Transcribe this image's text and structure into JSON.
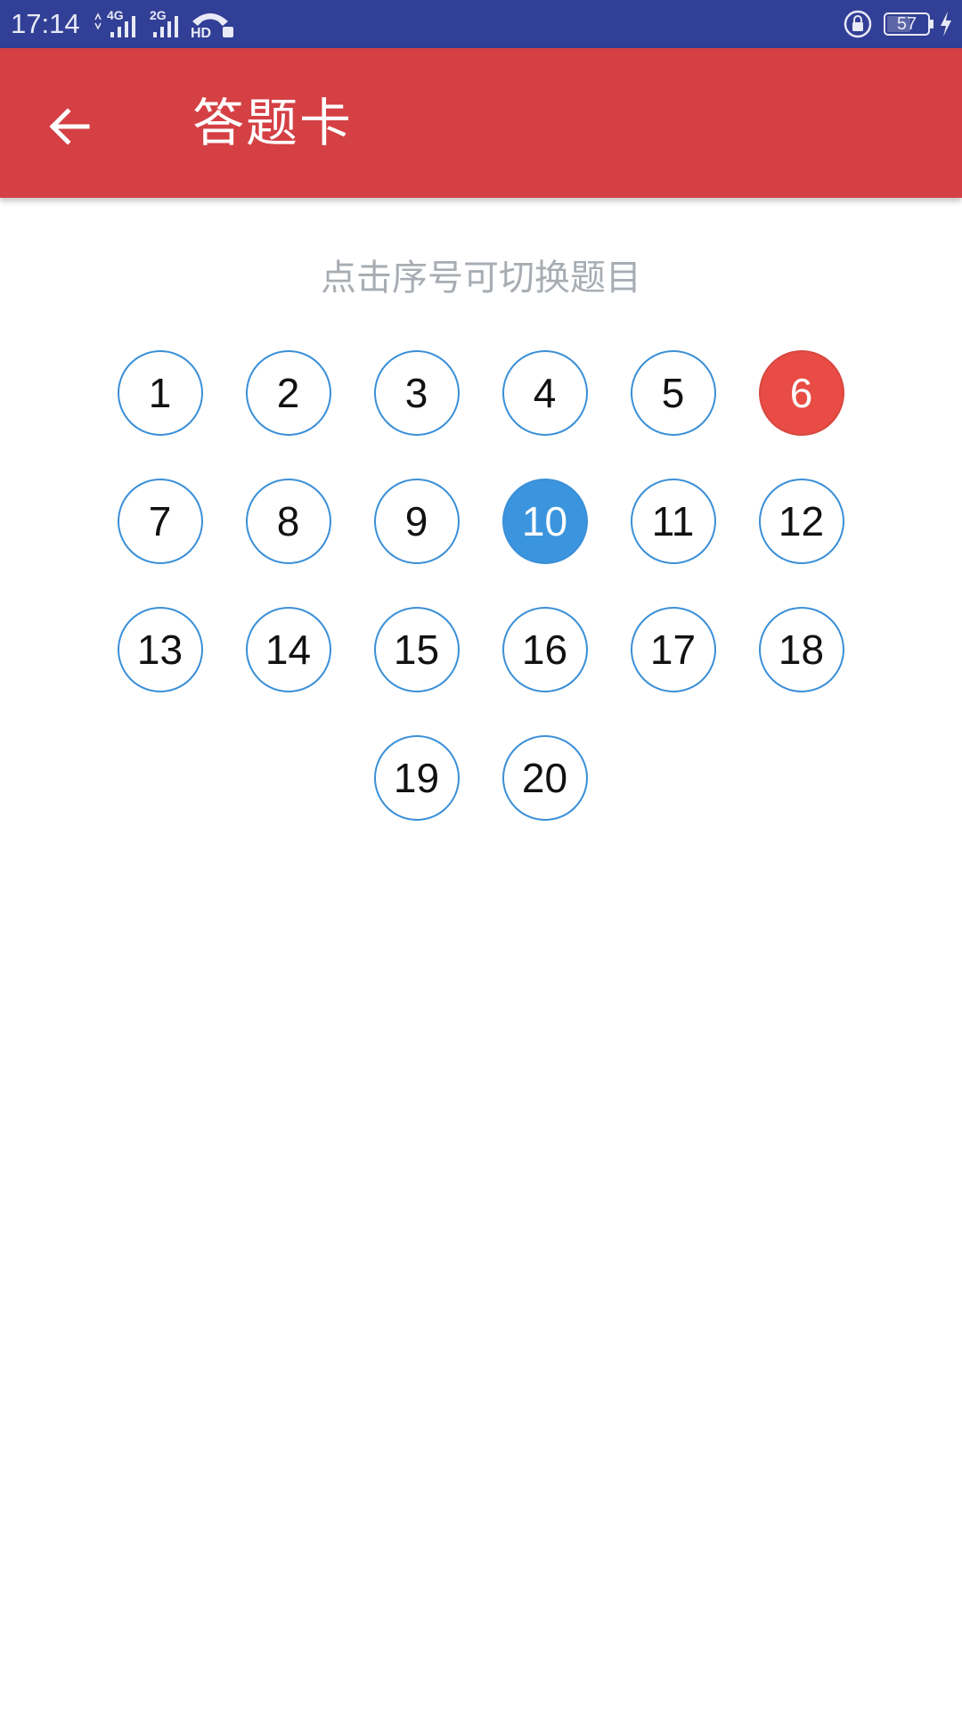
{
  "status_bar": {
    "time": "17:14",
    "network_1": "4G",
    "network_2": "2G",
    "hd_label": "HD",
    "battery": "57",
    "icons": [
      "signal-4g-icon",
      "signal-2g-icon",
      "hd-call-icon",
      "rotation-lock-icon",
      "battery-icon",
      "charging-icon"
    ]
  },
  "app_bar": {
    "back_icon": "arrow-left-icon",
    "title": "答题卡",
    "background": "#d44044"
  },
  "hint": "点击序号可切换题目",
  "questions": [
    {
      "num": "1",
      "state": "normal"
    },
    {
      "num": "2",
      "state": "normal"
    },
    {
      "num": "3",
      "state": "normal"
    },
    {
      "num": "4",
      "state": "normal"
    },
    {
      "num": "5",
      "state": "normal"
    },
    {
      "num": "6",
      "state": "wrong"
    },
    {
      "num": "7",
      "state": "normal"
    },
    {
      "num": "8",
      "state": "normal"
    },
    {
      "num": "9",
      "state": "normal"
    },
    {
      "num": "10",
      "state": "current"
    },
    {
      "num": "11",
      "state": "normal"
    },
    {
      "num": "12",
      "state": "normal"
    },
    {
      "num": "13",
      "state": "normal"
    },
    {
      "num": "14",
      "state": "normal"
    },
    {
      "num": "15",
      "state": "normal"
    },
    {
      "num": "16",
      "state": "normal"
    },
    {
      "num": "17",
      "state": "normal"
    },
    {
      "num": "18",
      "state": "normal"
    },
    {
      "num": "19",
      "state": "normal"
    },
    {
      "num": "20",
      "state": "normal"
    }
  ],
  "colors": {
    "status_bar": "#323f96",
    "circle_border": "#3a8fd8",
    "wrong": "#e84c44",
    "current": "#3a95de",
    "hint": "#a7adb3"
  }
}
